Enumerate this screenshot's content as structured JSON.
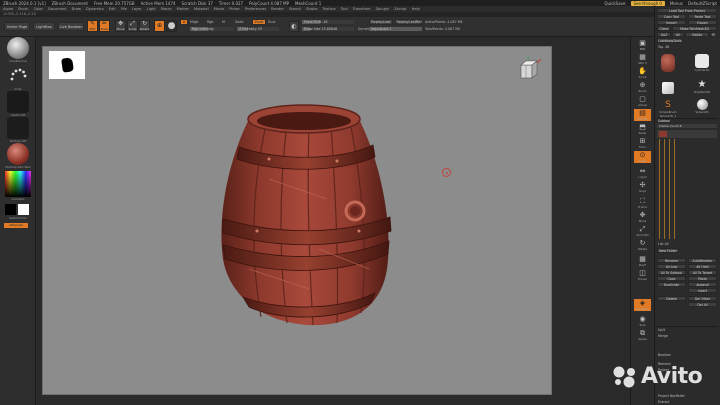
{
  "titlebar": {
    "title": "ZBrush 2024.0.1 [v1]",
    "document": "ZBrush Document",
    "stats": [
      "Free Mem 20.757GB",
      "Active Mem 1474",
      "Scratch Disk 37",
      "Timer 0.027",
      "PolyCount 4.087 MP",
      "MeshCount 1"
    ],
    "quicksave": "QuickSave",
    "see_through": "See-through  0",
    "menus_label": "Menus",
    "default_zscript": "DefaultZScript"
  },
  "menubar": {
    "items": [
      "Alpha",
      "Brush",
      "Color",
      "Document",
      "Draw",
      "Dynamics",
      "Edit",
      "File",
      "Layer",
      "Light",
      "Macro",
      "Marker",
      "Material",
      "Movie",
      "Picker",
      "Preferences",
      "Render",
      "Stencil",
      "Stroke",
      "Texture",
      "Tool",
      "Transform",
      "Zplugin",
      "Zscript",
      "Help"
    ]
  },
  "infobar": {
    "text": "-0.005,-0.116,-0.24"
  },
  "toolbar": {
    "home_page": "Home Page",
    "lightbox": "LightBox",
    "live_boolean": "Live Boolean",
    "edit": "Edit",
    "draw": "Draw",
    "move": "Move",
    "scale": "Scale",
    "rotate": "Rotate",
    "mrgb": "Mrgb",
    "rgb": "Rgb",
    "m": "M",
    "zadd": "Zadd",
    "zsub": "Zsub",
    "zcut": "Zcut",
    "rgb_intensity": "Rgb Intensity",
    "z_intensity": "Z Intensity 25",
    "focal_shift": "Focal Shift -18",
    "draw_size": "Draw Size 25.85648",
    "dynamic": "Dynamic",
    "replay_last": "ReplayLast",
    "replay_last_rel": "ReplayLastRel",
    "adjust_last": "AdjustLast 1",
    "active_points": "ActivePoints: 4.087 Mil",
    "total_points": "TotalPoints: 4.087 Mil",
    "a_label": "A"
  },
  "left_tray": {
    "brush_name": "ClayBuildup",
    "stroke_name": "Dots",
    "alpha_name": "Alpha Off",
    "texture_name": "Texture Off",
    "material_name": "MatCap Red Wax",
    "gradient": "Gradient",
    "switch_color": "SwitchColor",
    "alternate": "Alternate"
  },
  "right_shelf": {
    "buttons": [
      "BPR",
      "SPix 3",
      "Scroll",
      "Zoom",
      "Actual",
      "AAHalf",
      "Persp",
      "Floor",
      "Local",
      "L.Sym",
      "Gxyz",
      "Frame",
      "Move",
      "Zoom3D",
      "Rotate",
      "PolyF",
      "Transp",
      "Dynamic",
      "Solo",
      "Xpose"
    ]
  },
  "tool_tray": {
    "header": "Load Tool From Project",
    "copy_tool": "Copy Tool",
    "paste_tool": "Paste Tool",
    "import": "Import",
    "export": "Export",
    "clone": "Clone",
    "make_polymesh": "Make PolyMesh3D",
    "goz": "GoZ",
    "all": "All",
    "visible": "Visible",
    "r": "R",
    "lightbox_tools": "Lightbox▸Tools",
    "tool_name": "Tsp. 48",
    "tools": [
      "Cylinder3D",
      "PolyMesh3D",
      "SimpleBrush",
      "Sphere3D",
      "Sphere3D_1"
    ],
    "subtool": "Subtool",
    "visible_count": "Visible Count 8",
    "list_all": "List All",
    "new_folder": "New Folder",
    "rename": "Rename",
    "auto_reorder": "AutoReorder",
    "all_low": "All Low",
    "all_high": "All High",
    "all_to_subtool": "All To Subtool",
    "all_to_target": "All To Target",
    "copy": "Copy",
    "paste": "Paste",
    "duplicate": "Duplicate",
    "append": "Append",
    "insert": "Insert",
    "delete": "Delete",
    "del_other": "Del Other",
    "del_all": "Del All",
    "split": "Split",
    "merge": "Merge",
    "boolean": "Boolean",
    "remesh": "Remesh",
    "project": "Project",
    "project_bas_relief": "Project BasRelief",
    "extract": "Extract"
  },
  "watermark": {
    "brand": "Avito"
  },
  "colors": {
    "accent": "#e07a25",
    "viewport_bg": "#8c8c8c",
    "wax_red": "#a8493b"
  }
}
